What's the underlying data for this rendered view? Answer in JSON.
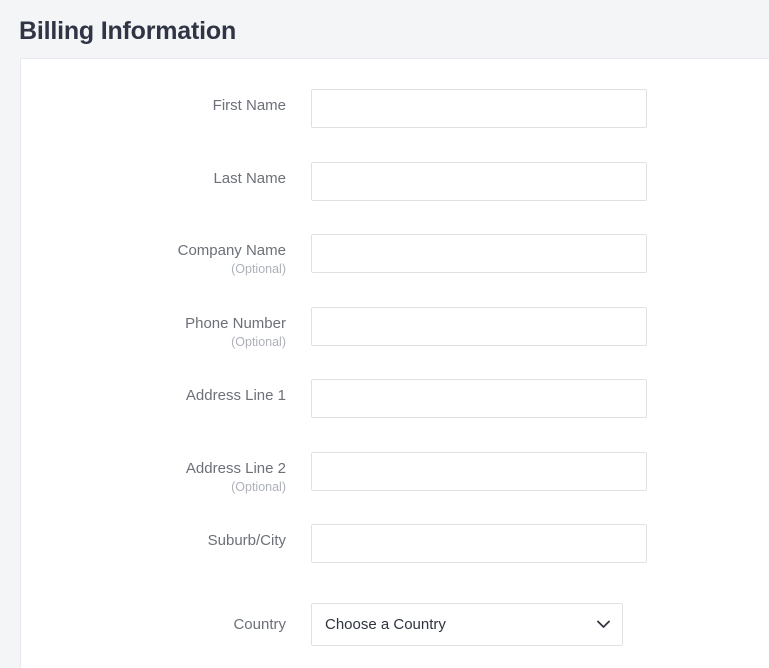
{
  "header": {
    "title": "Billing Information"
  },
  "colors": {
    "page_background": "#f4f5f7",
    "card_background": "#ffffff",
    "title_text": "#303546",
    "label_text": "#6c7078",
    "optional_text": "#adb1b8",
    "input_border": "#dfe1e5",
    "value_text": "#2f3440"
  },
  "form": {
    "fields": [
      {
        "label": "First Name",
        "optional": "",
        "type": "text",
        "value": "",
        "placeholder": ""
      },
      {
        "label": "Last Name",
        "optional": "",
        "type": "text",
        "value": "",
        "placeholder": ""
      },
      {
        "label": "Company Name",
        "optional": "(Optional)",
        "type": "text",
        "value": "",
        "placeholder": ""
      },
      {
        "label": "Phone Number",
        "optional": "(Optional)",
        "type": "text",
        "value": "",
        "placeholder": ""
      },
      {
        "label": "Address Line 1",
        "optional": "",
        "type": "text",
        "value": "",
        "placeholder": ""
      },
      {
        "label": "Address Line 2",
        "optional": "(Optional)",
        "type": "text",
        "value": "",
        "placeholder": ""
      },
      {
        "label": "Suburb/City",
        "optional": "",
        "type": "text",
        "value": "",
        "placeholder": ""
      },
      {
        "label": "Country",
        "optional": "",
        "type": "select",
        "value": "Choose a Country",
        "options": [
          "Choose a Country"
        ],
        "icon": "chevron-down-icon"
      }
    ]
  }
}
